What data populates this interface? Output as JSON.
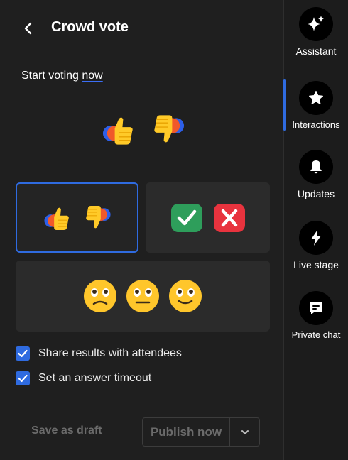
{
  "header": {
    "title": "Crowd vote"
  },
  "intro": {
    "prefix": "Start voting ",
    "link": "now"
  },
  "options": [
    {
      "label": "thumbs-up-down",
      "selected": true
    },
    {
      "label": "check-cross",
      "selected": false
    },
    {
      "label": "faces",
      "selected": false
    }
  ],
  "settings": {
    "share_results": {
      "label": "Share results with attendees",
      "checked": true
    },
    "answer_timeout": {
      "label": "Set an answer timeout",
      "checked": true
    }
  },
  "footer": {
    "save_draft": "Save as draft",
    "publish": "Publish now"
  },
  "rail": {
    "items": [
      {
        "label": "Assistant",
        "icon": "sparkle-icon"
      },
      {
        "label": "Interactions",
        "icon": "star-icon",
        "active": true
      },
      {
        "label": "Updates",
        "icon": "bell-icon"
      },
      {
        "label": "Live stage",
        "icon": "lightning-icon"
      },
      {
        "label": "Private chat",
        "icon": "chat-icon"
      }
    ]
  },
  "colors": {
    "accent": "#2f6be0",
    "panel_bg": "#1f1f1f",
    "card_bg": "#2b2b2b"
  }
}
